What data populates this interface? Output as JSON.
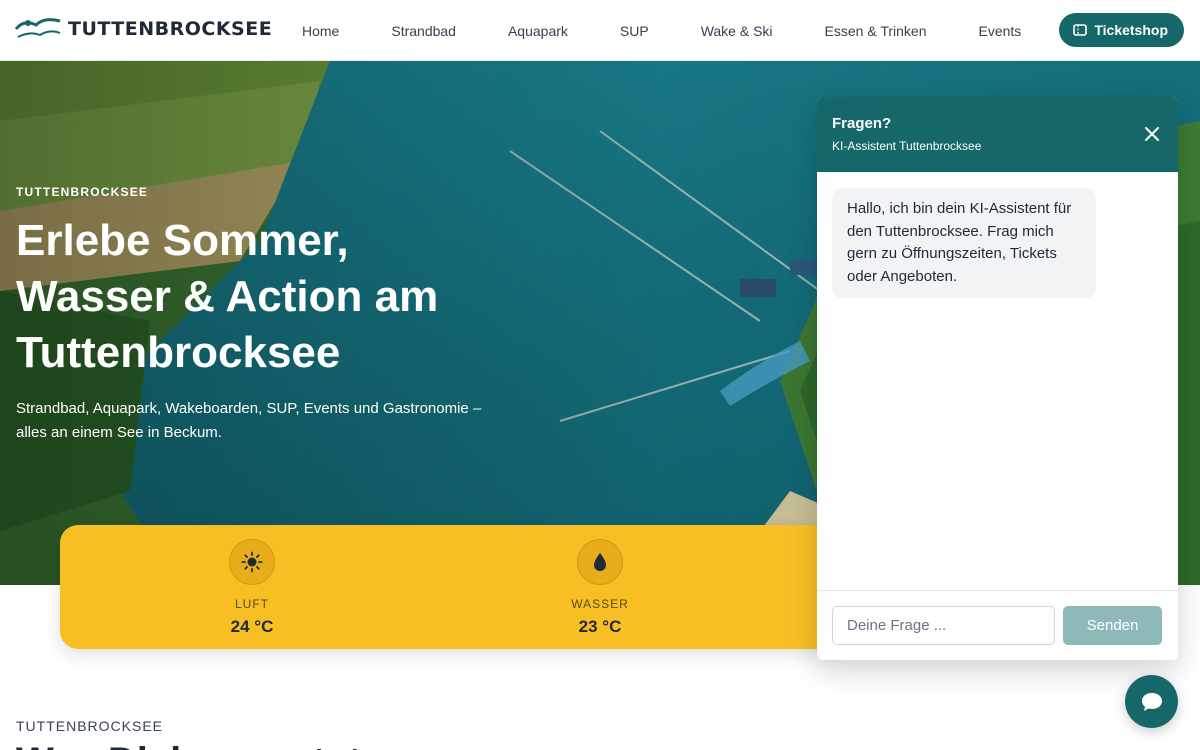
{
  "brand": {
    "logo_text": "TUTTENBROCKSEE"
  },
  "nav": {
    "items": [
      {
        "label": "Home"
      },
      {
        "label": "Strandbad"
      },
      {
        "label": "Aquapark"
      },
      {
        "label": "SUP"
      },
      {
        "label": "Wake & Ski"
      },
      {
        "label": "Essen & Trinken"
      },
      {
        "label": "Events"
      }
    ],
    "ticket_label": "Ticketshop"
  },
  "hero": {
    "eyebrow": "TUTTENBROCKSEE",
    "title_line1": "Erlebe Sommer,",
    "title_line2": "Wasser & Action am",
    "title_line3": "Tuttenbrocksee",
    "subtitle": "Strandbad, Aquapark, Wakeboarden, SUP, Events und Gastronomie – alles an einem See in Beckum."
  },
  "weather": {
    "items": [
      {
        "label": "LUFT",
        "value": "24 °C",
        "icon": "sun-icon"
      },
      {
        "label": "WASSER",
        "value": "23 °C",
        "icon": "water-drop-icon"
      }
    ]
  },
  "section": {
    "eyebrow": "TUTTENBROCKSEE",
    "title": "Was Dich erwartet"
  },
  "chat": {
    "title": "Fragen?",
    "subtitle": "KI-Assistent Tuttenbrocksee",
    "message": "Hallo, ich bin dein KI-Assistent für den Tuttenbrocksee. Frag mich gern zu Öffnungszeiten, Tickets oder Angeboten.",
    "input_placeholder": "Deine Frage ...",
    "send_label": "Senden"
  },
  "colors": {
    "primary": "#16676a",
    "accent": "#f8bf24",
    "send_disabled": "#8fb9b9"
  }
}
